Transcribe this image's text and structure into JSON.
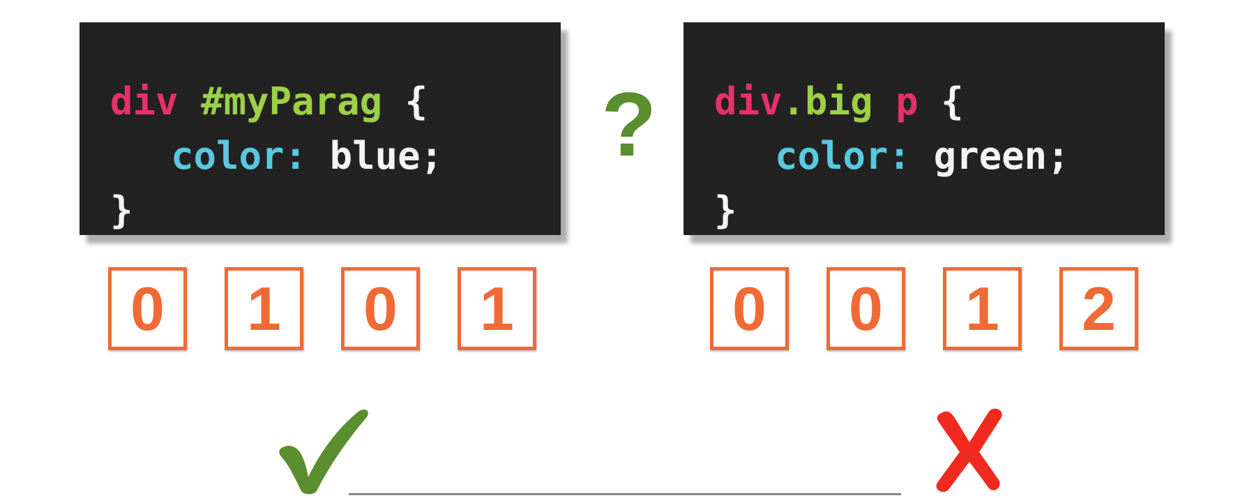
{
  "left_rule": {
    "line1": [
      "div",
      "#myParag",
      "{"
    ],
    "property": "color:",
    "value": "blue;",
    "close": "}"
  },
  "right_rule": {
    "line1": [
      "div.big",
      "p",
      "{"
    ],
    "property": "color:",
    "value": "green;",
    "close": "}"
  },
  "question_mark": "?",
  "left_specificity": [
    "0",
    "1",
    "0",
    "1"
  ],
  "right_specificity": [
    "0",
    "0",
    "1",
    "2"
  ],
  "left_result": "check-icon",
  "right_result": "cross-icon",
  "colors": {
    "code_background": "#222222",
    "selector_element": "#e8306a",
    "selector_id_class": "#9cd045",
    "property": "#58c9e0",
    "value": "#f4f4f4",
    "question": "#5a8e2e",
    "digit": "#f06a35",
    "check": "#5a8e2e",
    "cross": "#f02a1e"
  }
}
